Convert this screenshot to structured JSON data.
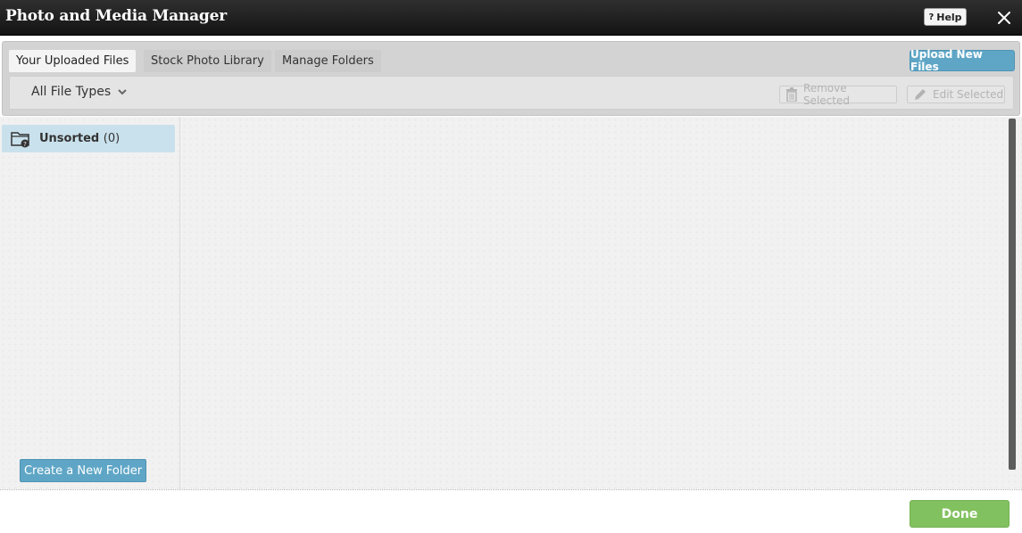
{
  "window": {
    "title": "Photo and Media Manager",
    "help_label": "Help",
    "help_symbol": "?"
  },
  "tabs": [
    {
      "label": "Your Uploaded Files",
      "active": true
    },
    {
      "label": "Stock Photo Library",
      "active": false
    },
    {
      "label": "Manage Folders",
      "active": false
    }
  ],
  "toolbar": {
    "upload_label": "Upload New Files",
    "file_type_filter": "All File Types",
    "remove_label": "Remove Selected",
    "edit_label": "Edit Selected"
  },
  "sidebar": {
    "folders": [
      {
        "name": "Unsorted",
        "count": "(0)"
      }
    ],
    "create_folder_label": "Create a New Folder"
  },
  "footer": {
    "done_label": "Done"
  },
  "icons": {
    "close": "close-icon",
    "dropdown": "chevron-down-icon",
    "remove": "trash-icon",
    "edit": "pencil-icon",
    "folder": "folder-icon"
  },
  "colors": {
    "accent_blue": "#5fa6c6",
    "done_green": "#82c15f",
    "selected_folder": "#c9e1ec",
    "titlebar": "#1e1e1e"
  }
}
